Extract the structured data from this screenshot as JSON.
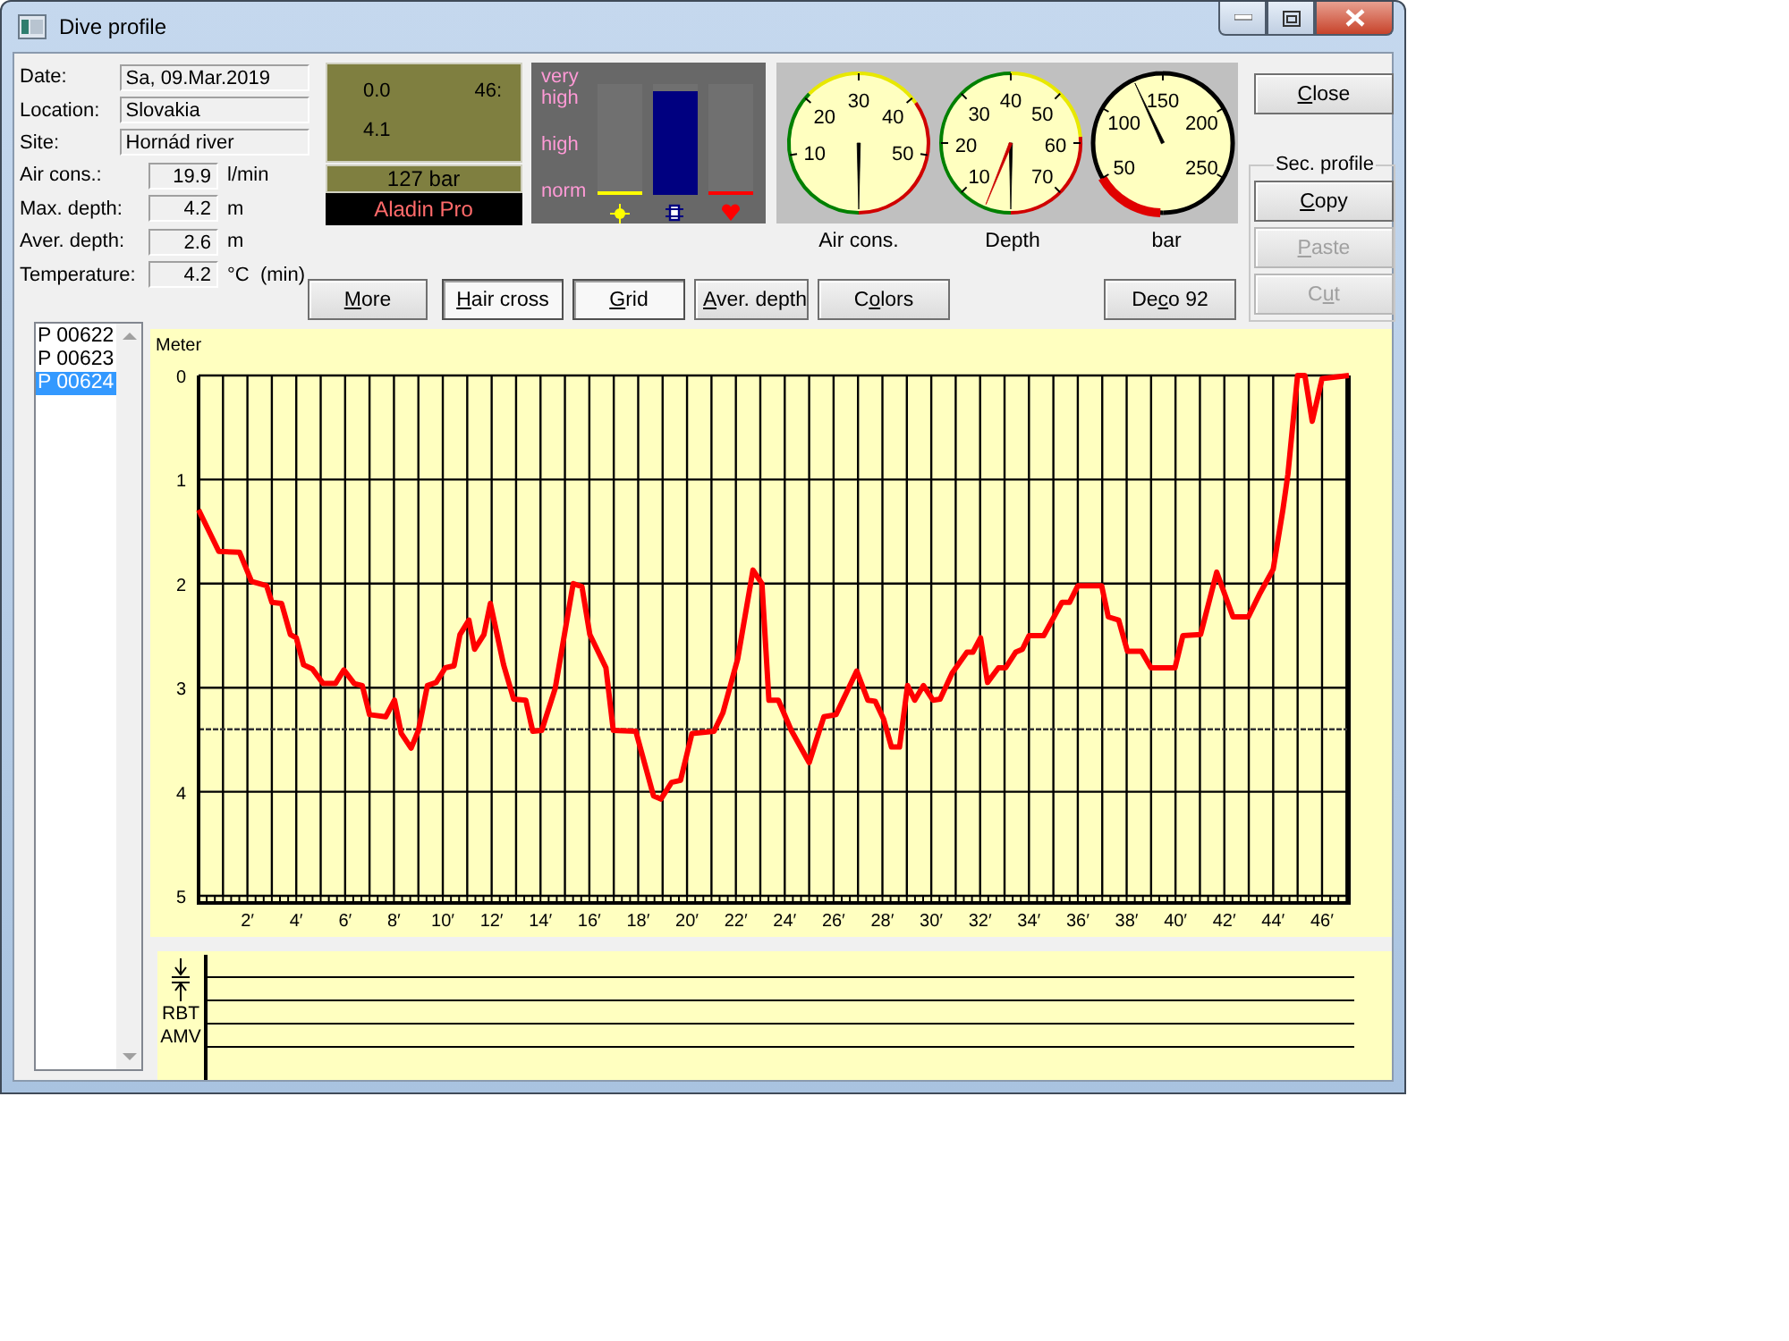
{
  "window": {
    "title": "Dive profile"
  },
  "info": {
    "text_fields": [
      {
        "label": "Date:",
        "value": "Sa, 09.Mar.2019"
      },
      {
        "label": "Location:",
        "value": "Slovakia"
      },
      {
        "label": "Site:",
        "value": "Hornád river"
      }
    ],
    "readouts": [
      {
        "label": "Air cons.:",
        "value": "19.9",
        "unit": "l/min"
      },
      {
        "label": "Max. depth:",
        "value": "4.2",
        "unit": "m"
      },
      {
        "label": "Aver. depth:",
        "value": "2.6",
        "unit": "m"
      },
      {
        "label": "Temperature:",
        "value": "4.2",
        "unit": "°C  (min)"
      }
    ]
  },
  "display": {
    "depth": "0.0",
    "time": "46:",
    "reading": "4.1",
    "pressure": "127 bar",
    "computer": "Aladin Pro"
  },
  "meter": {
    "scale": [
      "very high",
      "high",
      "norm"
    ],
    "bars": [
      {
        "kind": "sun",
        "color": "#ffff00",
        "level": 0
      },
      {
        "kind": "chip",
        "color": "#000080",
        "level": 0.93
      },
      {
        "kind": "heart",
        "color": "#ff0000",
        "level": 0
      }
    ]
  },
  "gauges": [
    {
      "kind": "air",
      "title": "Air cons.",
      "labels": [
        "10",
        "20",
        "30",
        "40",
        "50"
      ]
    },
    {
      "kind": "depth",
      "title": "Depth",
      "labels": [
        "10",
        "20",
        "30",
        "40",
        "50",
        "60",
        "70"
      ]
    },
    {
      "kind": "pressure",
      "title": "bar",
      "labels": [
        "50",
        "100",
        "150",
        "200",
        "250"
      ]
    }
  ],
  "buttons": [
    {
      "key": "M",
      "post": "ore",
      "pressed": false
    },
    {
      "key": "H",
      "post": "air cross",
      "pressed": true
    },
    {
      "key": "G",
      "post": "rid",
      "pressed": true
    },
    {
      "key": "A",
      "post": "ver. depth",
      "pressed": false
    },
    {
      "pre": "C",
      "key": "o",
      "post": "lors",
      "pressed": false
    },
    {
      "pre": "De",
      "key": "c",
      "post": "o 92",
      "pressed": false
    }
  ],
  "close_button": {
    "key": "C",
    "post": "lose"
  },
  "secondary_profile": {
    "title": "Sec. profile",
    "buttons": [
      {
        "key": "C",
        "post": "opy",
        "disabled": false
      },
      {
        "key": "P",
        "post": "aste",
        "disabled": true
      },
      {
        "pre": "C",
        "key": "u",
        "post": "t",
        "disabled": true
      }
    ]
  },
  "profiles": [
    {
      "label": "P 00622",
      "selected": false
    },
    {
      "label": "P 00623",
      "selected": false
    },
    {
      "label": "P 00624",
      "selected": true
    }
  ],
  "chart_data": {
    "type": "line",
    "ylabel": "Meter",
    "x": [
      0,
      0.83,
      1.68,
      2.17,
      2.78,
      3,
      3.4,
      3.76,
      4,
      4.3,
      4.66,
      5.1,
      5.6,
      5.95,
      6.37,
      6.7,
      7,
      7.66,
      8.02,
      8.3,
      8.7,
      9,
      9.37,
      9.73,
      10.1,
      10.46,
      10.7,
      11.07,
      11.3,
      11.68,
      11.95,
      12.49,
      12.9,
      13.4,
      13.68,
      14.05,
      14.6,
      15.34,
      15.7,
      16.02,
      16.68,
      16.98,
      17.9,
      18.63,
      18.93,
      19.37,
      19.73,
      20.2,
      21.1,
      21.47,
      22.08,
      22.7,
      23.07,
      23.35,
      23.74,
      24.27,
      25,
      25.6,
      26.1,
      26.95,
      27.4,
      27.7,
      28.05,
      28.37,
      28.7,
      29.03,
      29.32,
      29.68,
      30.07,
      30.36,
      30.85,
      31.46,
      31.7,
      32.02,
      32.3,
      32.75,
      33.04,
      33.45,
      33.73,
      34,
      34.6,
      35.35,
      35.66,
      36,
      36.98,
      37.25,
      37.67,
      38.03,
      38.6,
      39,
      39.98,
      40.3,
      41.03,
      41.69,
      42.35,
      42.98,
      43.47,
      44,
      44.4,
      44.6,
      45,
      45.3,
      45.6,
      46,
      47.1
    ],
    "series": [
      {
        "color": "#ff0000",
        "values": [
          1.29,
          1.69,
          1.7,
          1.98,
          2.02,
          2.18,
          2.19,
          2.49,
          2.52,
          2.78,
          2.82,
          2.96,
          2.96,
          2.83,
          2.96,
          2.98,
          3.26,
          3.28,
          3.12,
          3.44,
          3.58,
          3.41,
          2.98,
          2.95,
          2.81,
          2.79,
          2.49,
          2.35,
          2.63,
          2.49,
          2.19,
          2.78,
          3.11,
          3.12,
          3.42,
          3.41,
          3.01,
          2,
          2.03,
          2.49,
          2.81,
          3.41,
          3.42,
          4.04,
          4.07,
          3.91,
          3.89,
          3.44,
          3.42,
          3.24,
          2.72,
          1.87,
          2,
          3.12,
          3.12,
          3.41,
          3.72,
          3.28,
          3.26,
          2.84,
          3.12,
          3.13,
          3.3,
          3.57,
          3.57,
          2.98,
          3.12,
          2.98,
          3.12,
          3.11,
          2.86,
          2.66,
          2.66,
          2.52,
          2.95,
          2.81,
          2.81,
          2.66,
          2.63,
          2.5,
          2.5,
          2.18,
          2.18,
          2.02,
          2.02,
          2.32,
          2.35,
          2.65,
          2.65,
          2.81,
          2.81,
          2.5,
          2.49,
          1.89,
          2.32,
          2.32,
          2.09,
          1.86,
          1.29,
          0.95,
          0,
          0,
          0.44,
          0.03,
          0
        ]
      }
    ],
    "xlim": [
      0,
      47.1
    ],
    "ylim": [
      5,
      0
    ],
    "xticks": [
      {
        "value": 2,
        "label": "2′"
      },
      {
        "value": 4,
        "label": "4′"
      },
      {
        "value": 6,
        "label": "6′"
      },
      {
        "value": 8,
        "label": "8′"
      },
      {
        "value": 10,
        "label": "10′"
      },
      {
        "value": 12,
        "label": "12′"
      },
      {
        "value": 14,
        "label": "14′"
      },
      {
        "value": 16,
        "label": "16′"
      },
      {
        "value": 18,
        "label": "18′"
      },
      {
        "value": 20,
        "label": "20′"
      },
      {
        "value": 22,
        "label": "22′"
      },
      {
        "value": 24,
        "label": "24′"
      },
      {
        "value": 26,
        "label": "26′"
      },
      {
        "value": 28,
        "label": "28′"
      },
      {
        "value": 30,
        "label": "30′"
      },
      {
        "value": 32,
        "label": "32′"
      },
      {
        "value": 34,
        "label": "34′"
      },
      {
        "value": 36,
        "label": "36′"
      },
      {
        "value": 38,
        "label": "38′"
      },
      {
        "value": 40,
        "label": "40′"
      },
      {
        "value": 42,
        "label": "42′"
      },
      {
        "value": 44,
        "label": "44′"
      },
      {
        "value": 46,
        "label": "46′"
      }
    ],
    "yticks": [
      0,
      1,
      2,
      3,
      4,
      5
    ],
    "grid": true,
    "ref_lines": [
      {
        "value": 3.4,
        "axis": "y"
      }
    ]
  },
  "event_track": {
    "rows": [
      {
        "kind": "descent"
      },
      {
        "kind": "ascent"
      },
      {
        "kind": "text",
        "label": "RBT"
      },
      {
        "kind": "text",
        "label": "AMV"
      }
    ]
  }
}
